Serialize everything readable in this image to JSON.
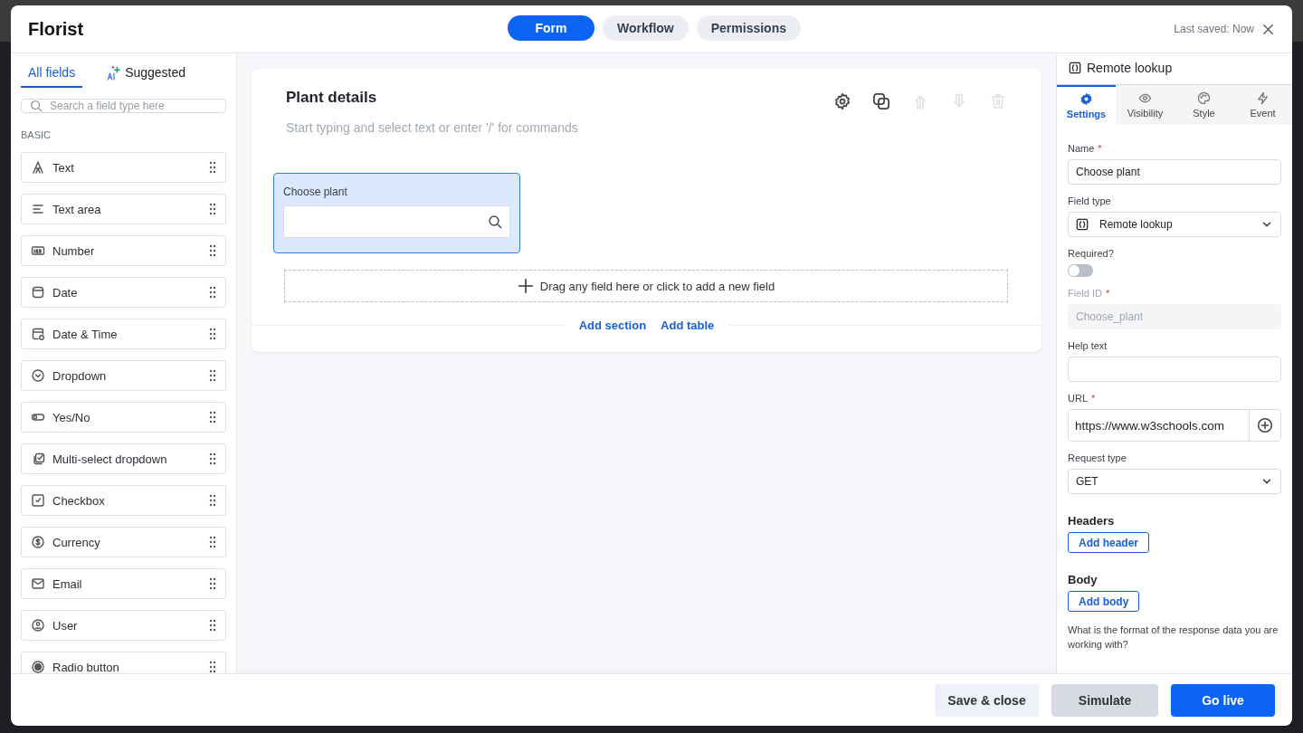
{
  "window": {
    "title": "Florist"
  },
  "view_tabs": [
    {
      "label": "Form",
      "selected": true
    },
    {
      "label": "Workflow",
      "selected": false
    },
    {
      "label": "Permissions",
      "selected": false
    }
  ],
  "last_saved": "Last saved: Now",
  "palette": {
    "tabs": [
      {
        "label": "All fields",
        "kind": "plain",
        "selected": true
      },
      {
        "label": "Suggested",
        "kind": "ai",
        "selected": false
      }
    ],
    "search": {
      "placeholder": "Search a field type here"
    },
    "section": "BASIC",
    "fields": [
      {
        "label": "Text",
        "kind": "text"
      },
      {
        "label": "Text area",
        "kind": "textarea"
      },
      {
        "label": "Number",
        "kind": "number"
      },
      {
        "label": "Date",
        "kind": "date"
      },
      {
        "label": "Date & Time",
        "kind": "datetime"
      },
      {
        "label": "Dropdown",
        "kind": "dropdown"
      },
      {
        "label": "Yes/No",
        "kind": "toggle"
      },
      {
        "label": "Multi-select dropdown",
        "kind": "multiselect"
      },
      {
        "label": "Checkbox",
        "kind": "checkbox"
      },
      {
        "label": "Currency",
        "kind": "currency"
      },
      {
        "label": "Email",
        "kind": "email"
      },
      {
        "label": "User",
        "kind": "user"
      },
      {
        "label": "Radio button",
        "kind": "radio"
      }
    ]
  },
  "section": {
    "title": "Plant details",
    "placeholder": "Start typing and select text or enter '/' for commands",
    "toolbar": [
      {
        "kind": "settings",
        "disabled": false
      },
      {
        "kind": "duplicate",
        "disabled": false
      },
      {
        "kind": "up",
        "disabled": true
      },
      {
        "kind": "down",
        "disabled": true
      },
      {
        "kind": "delete",
        "disabled": true
      }
    ],
    "fields": [
      {
        "label": "Choose plant",
        "selected": true
      }
    ],
    "drop_zone": "Drag any field here or click to add a new field",
    "links": [
      "Add section",
      "Add table"
    ]
  },
  "properties": {
    "title": "Remote lookup",
    "tabs": [
      {
        "label": "Settings",
        "kind": "settings",
        "selected": true
      },
      {
        "label": "Visibility",
        "kind": "visibility",
        "selected": false
      },
      {
        "label": "Style",
        "kind": "style",
        "selected": false
      },
      {
        "label": "Event",
        "kind": "event",
        "selected": false
      }
    ],
    "name": {
      "label": "Name",
      "required_mark": "*",
      "value": "Choose plant"
    },
    "field_type": {
      "label": "Field type",
      "value": "Remote lookup"
    },
    "required_toggle": {
      "label": "Required?",
      "on": false
    },
    "field_id": {
      "label": "Field ID",
      "required_mark": "*",
      "value": "Choose_plant",
      "disabled": true
    },
    "help_text": {
      "label": "Help text"
    },
    "url": {
      "label": "URL",
      "required_mark": "*",
      "value": "https://www.w3schools.com"
    },
    "request_type": {
      "label": "Request type",
      "value": "GET"
    },
    "headers": {
      "title": "Headers",
      "button": "Add header"
    },
    "body": {
      "title": "Body",
      "button": "Add body"
    },
    "response_question": "What is the format of the response data you are working with?"
  },
  "footer": {
    "buttons": [
      {
        "label": "Save & close",
        "kind": "secondary"
      },
      {
        "label": "Simulate",
        "kind": "hovered"
      },
      {
        "label": "Go live",
        "kind": "primary"
      }
    ]
  }
}
